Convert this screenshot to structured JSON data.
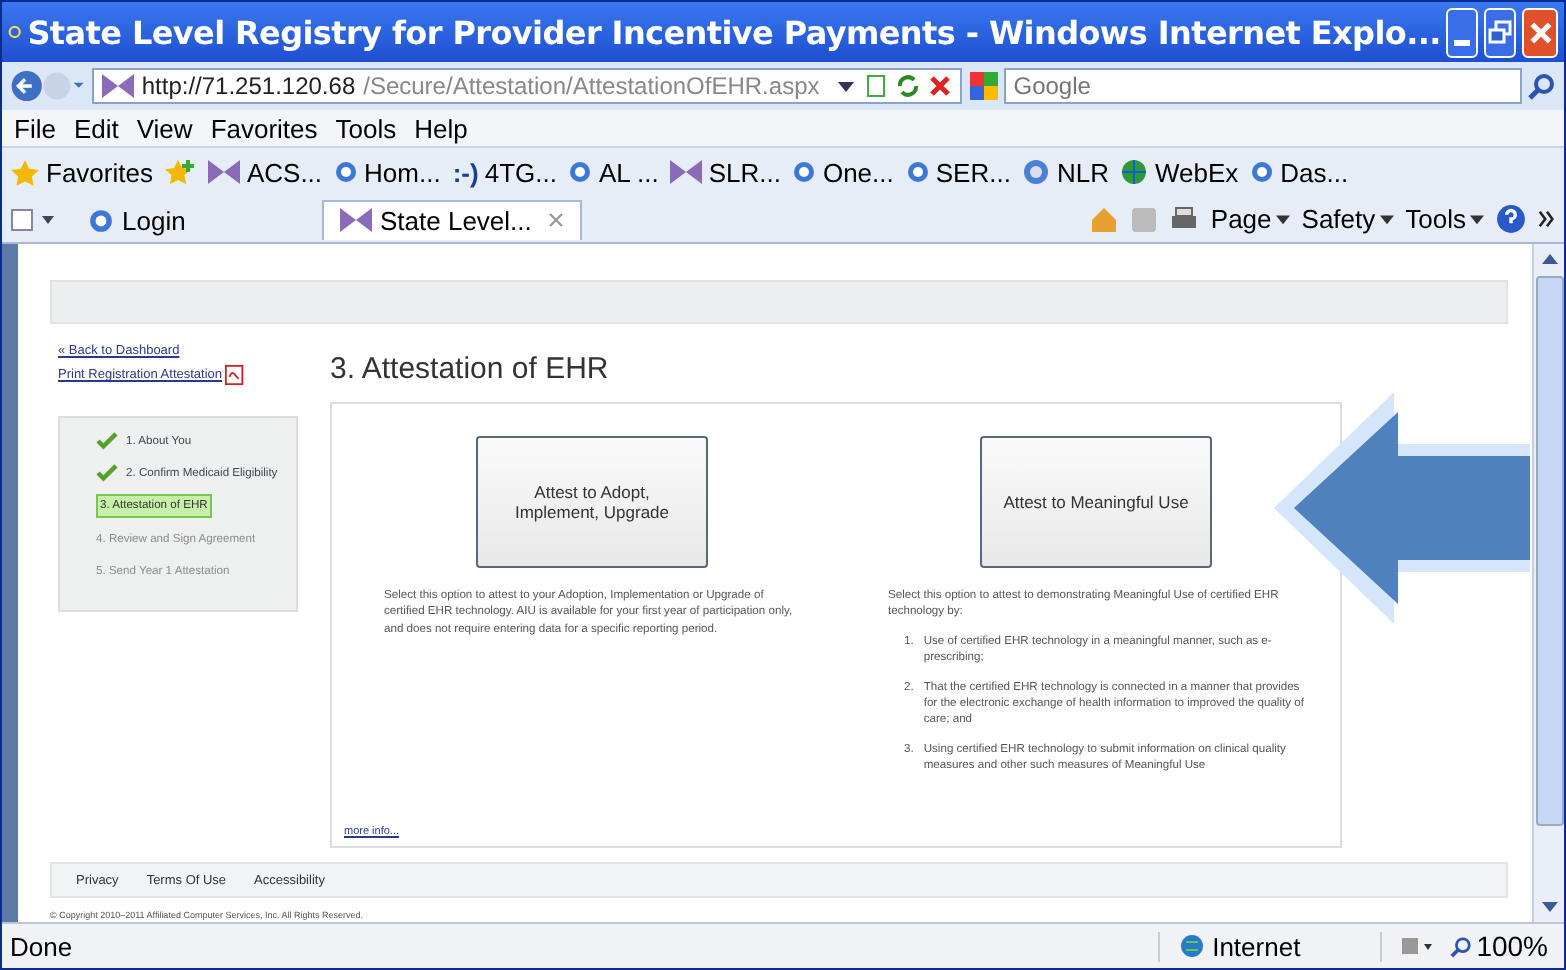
{
  "window": {
    "title": "State Level Registry for Provider Incentive Payments - Windows Internet Explo..."
  },
  "address_bar": {
    "url_host": "http://71.251.120.68",
    "url_path": "/Secure/Attestation/AttestationOfEHR.aspx",
    "search_placeholder": "Google"
  },
  "menu": [
    "File",
    "Edit",
    "View",
    "Favorites",
    "Tools",
    "Help"
  ],
  "favorites_bar": {
    "label": "Favorites",
    "items": [
      {
        "kind": "mail",
        "label": "ACS..."
      },
      {
        "kind": "ie",
        "label": "Hom..."
      },
      {
        "kind": "smiley",
        "icon_text": ":-)",
        "label": "4TG..."
      },
      {
        "kind": "ie",
        "label": "AL ..."
      },
      {
        "kind": "mail",
        "label": "SLR..."
      },
      {
        "kind": "ie",
        "label": "One..."
      },
      {
        "kind": "ie",
        "label": "SER..."
      },
      {
        "kind": "nlr",
        "label": "NLR"
      },
      {
        "kind": "globe",
        "label": "WebEx"
      },
      {
        "kind": "ie",
        "label": "Das..."
      }
    ]
  },
  "tabs": [
    {
      "label": "Login",
      "selected": false
    },
    {
      "label": "State Level...",
      "selected": true
    }
  ],
  "command_bar": [
    "Page",
    "Safety",
    "Tools"
  ],
  "page": {
    "back_link": "« Back to Dashboard",
    "print_link": "Print Registration Attestation",
    "steps": [
      {
        "kind": "done",
        "label": "1. About You"
      },
      {
        "kind": "done",
        "label": "2. Confirm Medicaid Eligibility"
      },
      {
        "kind": "current",
        "label": "3. Attestation of EHR"
      },
      {
        "kind": "pending",
        "label": "4. Review and Sign Agreement"
      },
      {
        "kind": "pending",
        "label": "5. Send Year 1 Attestation"
      }
    ],
    "heading": "3. Attestation of EHR",
    "options": [
      {
        "button": "Attest to Adopt, Implement, Upgrade",
        "description": "Select this option to attest to your Adoption, Implementation or Upgrade of certified EHR technology. AIU is available for your first year of participation only, and does not require entering data for a specific reporting period."
      },
      {
        "button": "Attest to Meaningful Use",
        "description": "Select this option to attest to demonstrating Meaningful Use of certified EHR technology by:",
        "items": [
          {
            "number": "1.",
            "text": "Use of certified EHR technology in a meaningful manner, such as e-prescribing;"
          },
          {
            "number": "2.",
            "text": "That the certified EHR technology is connected in a manner that provides for the electronic exchange of health information to improved the quality of care; and"
          },
          {
            "number": "3.",
            "text": "Using certified EHR technology to submit information on clinical quality measures and other such measures of Meaningful Use"
          }
        ]
      }
    ],
    "more_info": "more info...",
    "footer_links": [
      "Privacy",
      "Terms Of Use",
      "Accessibility"
    ],
    "copyright": "© Copyright 2010–2011 Affiliated Computer Services, Inc. All Rights Reserved."
  },
  "status_bar": {
    "text": "Done",
    "zone": "Internet",
    "zoom": "100%"
  }
}
